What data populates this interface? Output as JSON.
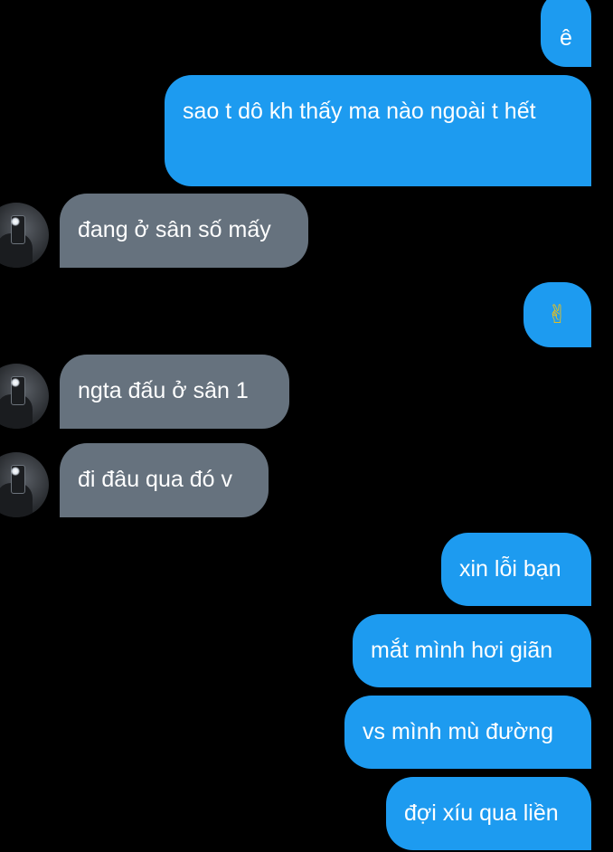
{
  "chat": {
    "messages": [
      {
        "id": "m1",
        "direction": "sent",
        "text": "ê"
      },
      {
        "id": "m2",
        "direction": "sent",
        "text": "sao t dô kh thấy ma nào ngoài t hết"
      },
      {
        "id": "m3",
        "direction": "received",
        "text": "đang ở sân số mấy"
      },
      {
        "id": "m4",
        "direction": "sent",
        "text": "✌"
      },
      {
        "id": "m5",
        "direction": "received",
        "text": "ngta đấu ở sân 1"
      },
      {
        "id": "m6",
        "direction": "received",
        "text": "đi đâu qua đó v"
      },
      {
        "id": "m7",
        "direction": "sent",
        "text": "xin lỗi bạn"
      },
      {
        "id": "m8",
        "direction": "sent",
        "text": "mắt mình hơi giãn"
      },
      {
        "id": "m9",
        "direction": "sent",
        "text": "vs mình mù đường"
      },
      {
        "id": "m10",
        "direction": "sent",
        "text": "đợi xíu qua liền"
      }
    ]
  },
  "colors": {
    "background": "#000000",
    "sent_bubble": "#1d9bf0",
    "received_bubble": "#66727e",
    "text": "#ffffff"
  }
}
